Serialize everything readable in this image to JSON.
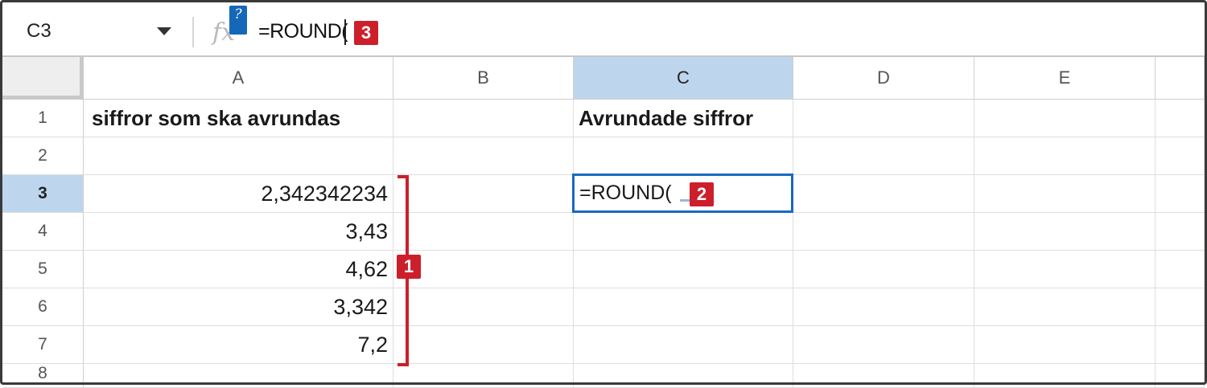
{
  "formula_bar": {
    "name_box": "C3",
    "fx_label": "fx",
    "help_label": "?",
    "formula": "=ROUND(",
    "badge": "3"
  },
  "columns": [
    "A",
    "B",
    "C",
    "D",
    "E"
  ],
  "active_column": "C",
  "rows": [
    "1",
    "2",
    "3",
    "4",
    "5",
    "6",
    "7",
    "8"
  ],
  "active_row": "3",
  "cells": {
    "A1": "siffror som ska avrundas",
    "C1": "Avrundade siffror",
    "A3": "2,342342234",
    "A4": "3,43",
    "A5": "4,62",
    "A6": "3,342",
    "A7": "7,2",
    "C3": "=ROUND("
  },
  "annotations": {
    "range_badge": "1",
    "cell_badge": "2"
  },
  "colors": {
    "accent_red": "#cc1f2b",
    "selection_blue": "#1a68c0",
    "header_active": "#bdd6ee"
  }
}
